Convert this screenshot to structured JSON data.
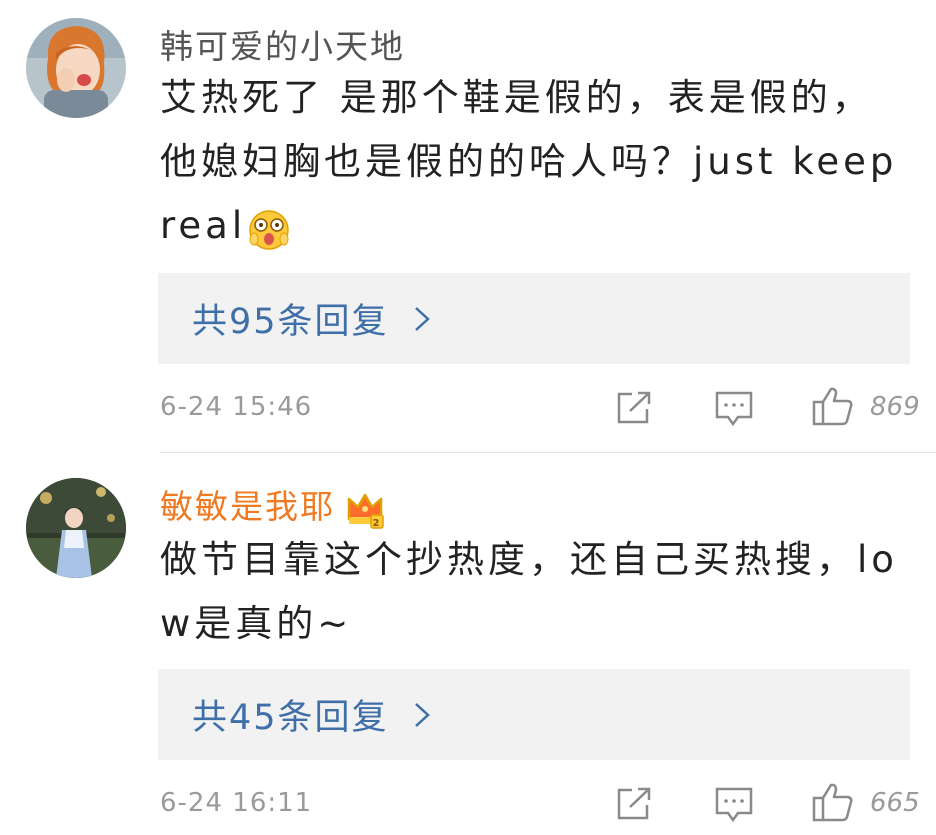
{
  "comments": [
    {
      "username": "韩可爱的小天地",
      "content": "艾热死了 是那个鞋是假的，表是假的，他媳妇胸也是假的的哈人吗？just keep real",
      "emoji_icon": "shocked-face-emoji",
      "reply_label": "共95条回复",
      "timestamp": "6-24 15:46",
      "like_count": "869"
    },
    {
      "username": "敏敏是我耶",
      "badge_icon": "crown-vip-icon",
      "content": "做节目靠这个抄热度，还自己买热搜，low是真的~",
      "reply_label": "共45条回复",
      "timestamp": "6-24 16:11",
      "like_count": "665"
    }
  ],
  "icons": {
    "share": "share-icon",
    "comment": "comment-icon",
    "like": "thumbs-up-icon",
    "chevron": "chevron-right-icon"
  },
  "colors": {
    "vip_name": "#f07a22",
    "reply_link": "#3f6fa8",
    "meta_gray": "#9a9a9a"
  }
}
